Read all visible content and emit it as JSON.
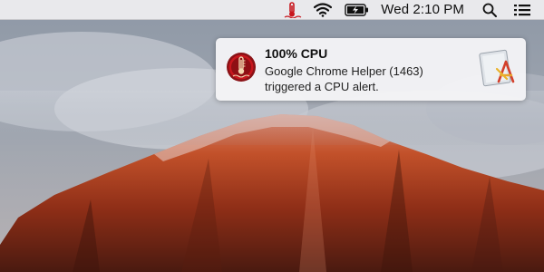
{
  "menubar": {
    "clock": "Wed 2:10 PM",
    "icons": [
      "thermometer-icon",
      "wifi-icon",
      "battery-icon",
      "search-icon",
      "list-icon"
    ]
  },
  "notification": {
    "title": "100% CPU",
    "line1": "Google Chrome Helper (1463)",
    "line2": "triggered a CPU alert.",
    "app_icon": "thermometer-app-icon",
    "content_image": "activity-monitor-icon"
  },
  "colors": {
    "menubar_bg": "#ececee",
    "alert_red": "#c8161d",
    "notif_bg": "#f4f4f6",
    "rock_orange": "#c8552a"
  }
}
